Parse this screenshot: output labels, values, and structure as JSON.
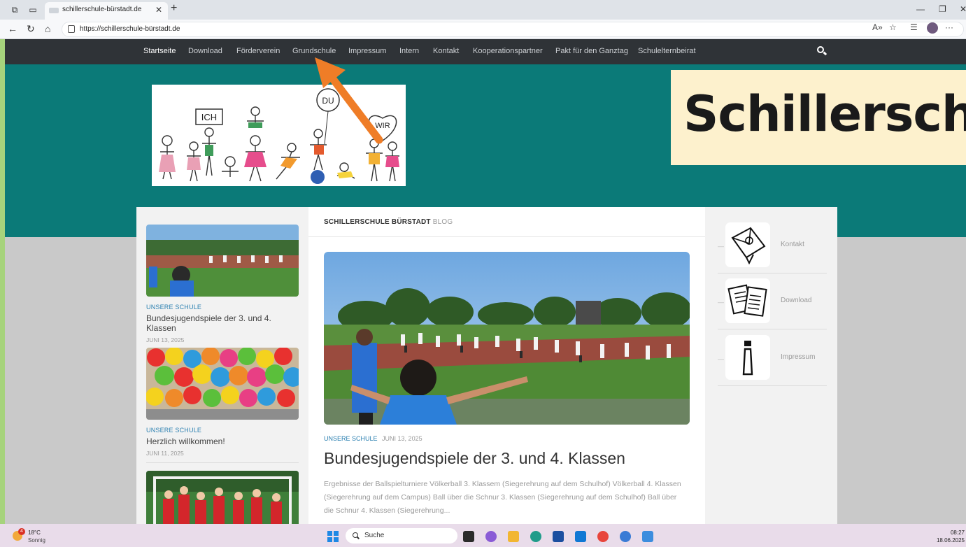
{
  "browser": {
    "tab_title": "schillerschule-bürstadt.de",
    "url": "https://schillerschule-bürstadt.de"
  },
  "nav": {
    "items": [
      "Startseite",
      "Download",
      "Förderverein",
      "Grundschule",
      "Impressum",
      "Intern",
      "Kontakt",
      "Kooperationspartner",
      "Pakt für den Ganztag",
      "Schulelternbeirat"
    ],
    "active": "Startseite"
  },
  "logo": {
    "words": [
      "ICH",
      "DU",
      "WIR"
    ]
  },
  "banner": {
    "text": "Schillersch"
  },
  "blog": {
    "heading": "SCHILLERSCHULE BÜRSTADT",
    "heading_sub": "BLOG"
  },
  "sidebar_posts": [
    {
      "category": "UNSERE SCHULE",
      "title": "Bundesjugendspiele der 3. und 4. Klassen",
      "date": "JUNI 13, 2025"
    },
    {
      "category": "UNSERE SCHULE",
      "title": "Herzlich willkommen!",
      "date": "JUNI 11, 2025"
    }
  ],
  "featured": {
    "category": "UNSERE SCHULE",
    "date": "JUNI 13, 2025",
    "title": "Bundesjugendspiele der 3. und 4. Klassen",
    "excerpt": "Ergebnisse der Ballspielturniere Völkerball 3. Klassem (Siegerehrung auf dem Schulhof) Völkerball 4. Klassen (Siegerehrung auf dem Campus) Ball über die Schnur 3. Klassen (Siegerehrung auf dem Schulhof) Ball über die Schnur 4. Klassen (Siegerehrung..."
  },
  "widgets": [
    {
      "label": "Kontakt",
      "icon": "envelope-icon"
    },
    {
      "label": "Download",
      "icon": "documents-icon"
    },
    {
      "label": "Impressum",
      "icon": "info-icon"
    }
  ],
  "taskbar": {
    "weather_temp": "18°C",
    "weather_cond": "Sonnig",
    "weather_badge": "4",
    "search_label": "Suche",
    "time": "08:27",
    "date": "18.06.2025"
  },
  "colors": {
    "teal": "#0b7a78",
    "nav_bg": "#2f3337",
    "link_blue": "#2a7fb0",
    "banner_bg": "#fdf1cd",
    "arrow": "#ef7d27"
  }
}
